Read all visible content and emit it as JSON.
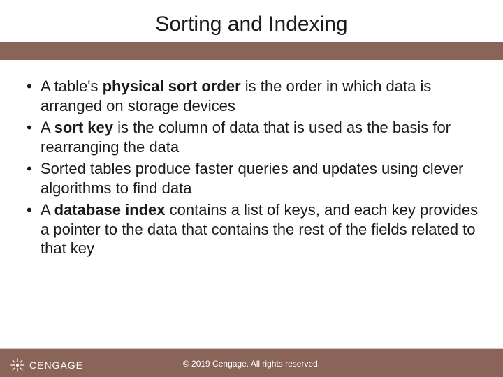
{
  "title": "Sorting and Indexing",
  "bullets": [
    {
      "pre": "A table's ",
      "bold": "physical sort order",
      "post": " is the order in which data is arranged on storage devices"
    },
    {
      "pre": "A ",
      "bold": "sort key",
      "post": " is the column of data that is used as the basis for rearranging the data"
    },
    {
      "pre": "",
      "bold": "",
      "post": "Sorted tables produce faster queries and updates using clever algorithms to find data"
    },
    {
      "pre": "A ",
      "bold": "database index",
      "post": " contains a list of keys, and each key provides a pointer to the data that contains the rest of the fields related to that key"
    }
  ],
  "footer": {
    "copyright": "© 2019 Cengage. All rights reserved.",
    "brand": "CENGAGE"
  }
}
